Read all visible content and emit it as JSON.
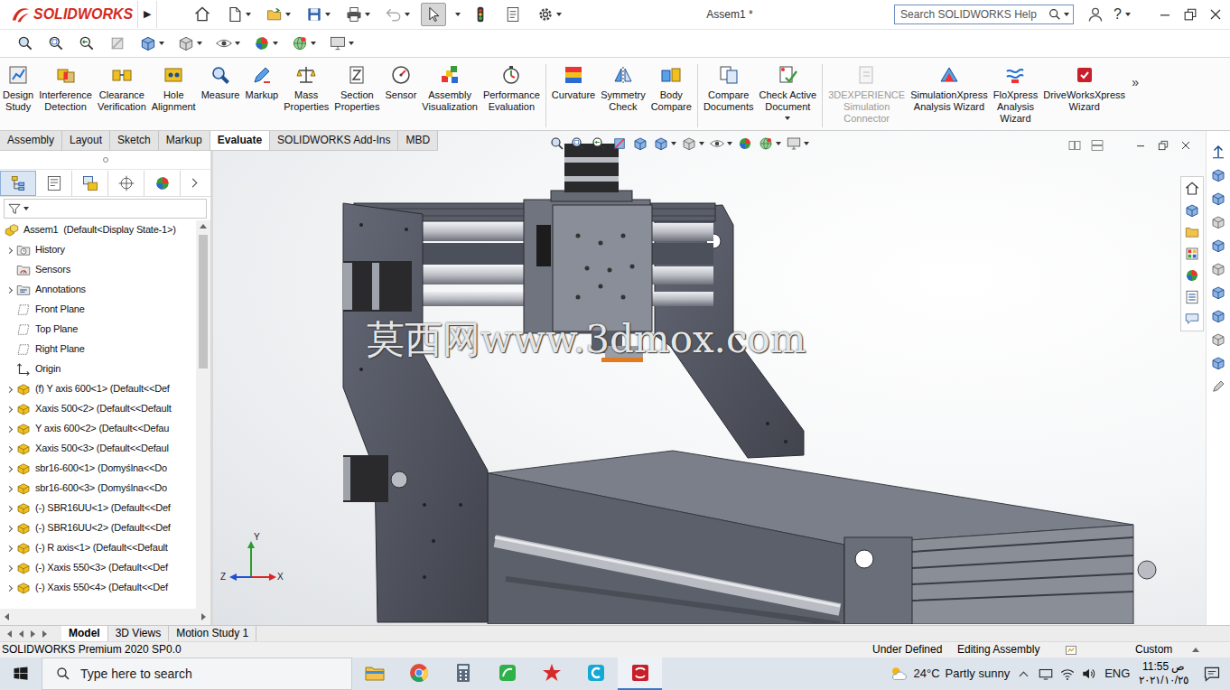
{
  "window": {
    "logo": "SOLIDWORKS",
    "flyout": "▶",
    "title": "Assem1 *",
    "help": "?"
  },
  "toolbar": {
    "select_active": true
  },
  "search": {
    "placeholder": "Search SOLIDWORKS Help"
  },
  "ribbon": {
    "groups": [
      [
        {
          "lines": [
            "Design",
            "Study"
          ],
          "disabled": false,
          "menu": false
        },
        {
          "lines": [
            "Interference",
            "Detection"
          ],
          "disabled": false,
          "menu": false
        },
        {
          "lines": [
            "Clearance",
            "Verification"
          ],
          "disabled": false,
          "menu": false
        },
        {
          "lines": [
            "Hole",
            "Alignment"
          ],
          "disabled": false,
          "menu": false
        },
        {
          "lines": [
            "Measure"
          ],
          "disabled": false,
          "menu": false
        },
        {
          "lines": [
            "Markup"
          ],
          "disabled": false,
          "menu": false
        },
        {
          "lines": [
            "Mass",
            "Properties"
          ],
          "disabled": false,
          "menu": false
        },
        {
          "lines": [
            "Section",
            "Properties"
          ],
          "disabled": false,
          "menu": false
        },
        {
          "lines": [
            "Sensor"
          ],
          "disabled": false,
          "menu": false
        },
        {
          "lines": [
            "Assembly",
            "Visualization"
          ],
          "disabled": false,
          "menu": false
        },
        {
          "lines": [
            "Performance",
            "Evaluation"
          ],
          "disabled": false,
          "menu": false
        }
      ],
      [
        {
          "lines": [
            "Curvature"
          ],
          "disabled": false,
          "menu": false
        },
        {
          "lines": [
            "Symmetry",
            "Check"
          ],
          "disabled": false,
          "menu": false
        },
        {
          "lines": [
            "Body",
            "Compare"
          ],
          "disabled": false,
          "menu": false
        }
      ],
      [
        {
          "lines": [
            "Compare",
            "Documents"
          ],
          "disabled": false,
          "menu": false
        },
        {
          "lines": [
            "Check Active",
            "Document"
          ],
          "disabled": false,
          "menu": true
        }
      ],
      [
        {
          "lines": [
            "3DEXPERIENCE",
            "Simulation",
            "Connector"
          ],
          "disabled": true,
          "menu": false
        },
        {
          "lines": [
            "SimulationXpress",
            "Analysis Wizard"
          ],
          "disabled": false,
          "menu": false
        },
        {
          "lines": [
            "FloXpress",
            "Analysis",
            "Wizard"
          ],
          "disabled": false,
          "menu": false
        },
        {
          "lines": [
            "DriveWorksXpress",
            "Wizard"
          ],
          "disabled": false,
          "menu": false
        }
      ]
    ],
    "more": "»"
  },
  "tabs": [
    {
      "label": "Assembly",
      "selected": false
    },
    {
      "label": "Layout",
      "selected": false
    },
    {
      "label": "Sketch",
      "selected": false
    },
    {
      "label": "Markup",
      "selected": false
    },
    {
      "label": "Evaluate",
      "selected": true
    },
    {
      "label": "SOLIDWORKS Add-Ins",
      "selected": false
    },
    {
      "label": "MBD",
      "selected": false
    }
  ],
  "panel_tabs": [
    {
      "kind": "feature",
      "selected": true
    },
    {
      "kind": "property",
      "selected": false
    },
    {
      "kind": "configuration",
      "selected": false
    },
    {
      "kind": "dimxpert",
      "selected": false
    },
    {
      "kind": "display",
      "selected": false
    }
  ],
  "feature_tree": {
    "root": "Assem1  (Default<Display State-1>)",
    "items": [
      {
        "label": "History",
        "kind": "history",
        "expandable": true
      },
      {
        "label": "Sensors",
        "kind": "sensors",
        "expandable": false
      },
      {
        "label": "Annotations",
        "kind": "annotations",
        "expandable": true
      },
      {
        "label": "Front Plane",
        "kind": "plane",
        "expandable": false
      },
      {
        "label": "Top Plane",
        "kind": "plane",
        "expandable": false
      },
      {
        "label": "Right Plane",
        "kind": "plane",
        "expandable": false
      },
      {
        "label": "Origin",
        "kind": "origin",
        "expandable": false
      },
      {
        "label": "(f) Y axis 600<1> (Default<<Def",
        "kind": "part",
        "expandable": true
      },
      {
        "label": "Xaxis 500<2> (Default<<Default",
        "kind": "part",
        "expandable": true
      },
      {
        "label": "Y axis 600<2> (Default<<Defau",
        "kind": "part",
        "expandable": true
      },
      {
        "label": "Xaxis 500<3> (Default<<Defaul",
        "kind": "part",
        "expandable": true
      },
      {
        "label": "sbr16-600<1> (Domyślna<<Do",
        "kind": "part",
        "expandable": true
      },
      {
        "label": "sbr16-600<3> (Domyślna<<Do",
        "kind": "part",
        "expandable": true
      },
      {
        "label": "(-) SBR16UU<1> (Default<<Def",
        "kind": "part",
        "expandable": true
      },
      {
        "label": "(-) SBR16UU<2> (Default<<Def",
        "kind": "part",
        "expandable": true
      },
      {
        "label": "(-) R axis<1> (Default<<Default",
        "kind": "part",
        "expandable": true
      },
      {
        "label": "(-) Xaxis 550<3> (Default<<Def",
        "kind": "part",
        "expandable": true
      },
      {
        "label": "(-) Xaxis 550<4> (Default<<Def",
        "kind": "part",
        "expandable": true
      }
    ]
  },
  "viewport": {
    "watermark": "莫西网www.3dmox.com",
    "triad": {
      "y": "Y",
      "z": "Z",
      "x": "X"
    }
  },
  "doc_tabs": [
    {
      "label": "Model",
      "selected": true
    },
    {
      "label": "3D Views",
      "selected": false
    },
    {
      "label": "Motion Study 1",
      "selected": false
    }
  ],
  "status_bar": {
    "product": "SOLIDWORKS Premium 2020 SP0.0",
    "state": "Under Defined",
    "mode": "Editing Assembly",
    "units": "Custom"
  },
  "taskbar": {
    "search_placeholder": "Type here to search",
    "apps": [
      {
        "kind": "explorer",
        "active": false
      },
      {
        "kind": "chrome",
        "active": false
      },
      {
        "kind": "calculator",
        "active": false
      },
      {
        "kind": "green",
        "active": false
      },
      {
        "kind": "red",
        "active": false
      },
      {
        "kind": "cyan",
        "active": false
      },
      {
        "kind": "solidworks",
        "active": true
      }
    ],
    "temperature": "24°C",
    "weather": "Partly sunny",
    "language": "ENG",
    "time": "11:55 ص",
    "date": "٢٠٢١/١٠/٢٥"
  }
}
